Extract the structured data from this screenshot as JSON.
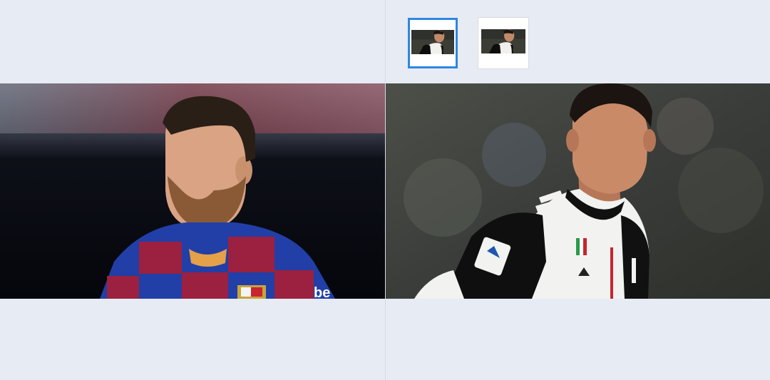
{
  "thumbnails": [
    {
      "icon": "photo-thumbnail-icon",
      "selected": true
    },
    {
      "icon": "photo-thumbnail-icon",
      "selected": false
    }
  ],
  "panels": {
    "left": {
      "icon": "photo-icon",
      "jersey_text": "be"
    },
    "right": {
      "icon": "photo-icon"
    }
  },
  "colors": {
    "background": "#e7ebf4",
    "selected_border": "#2f86e1"
  }
}
